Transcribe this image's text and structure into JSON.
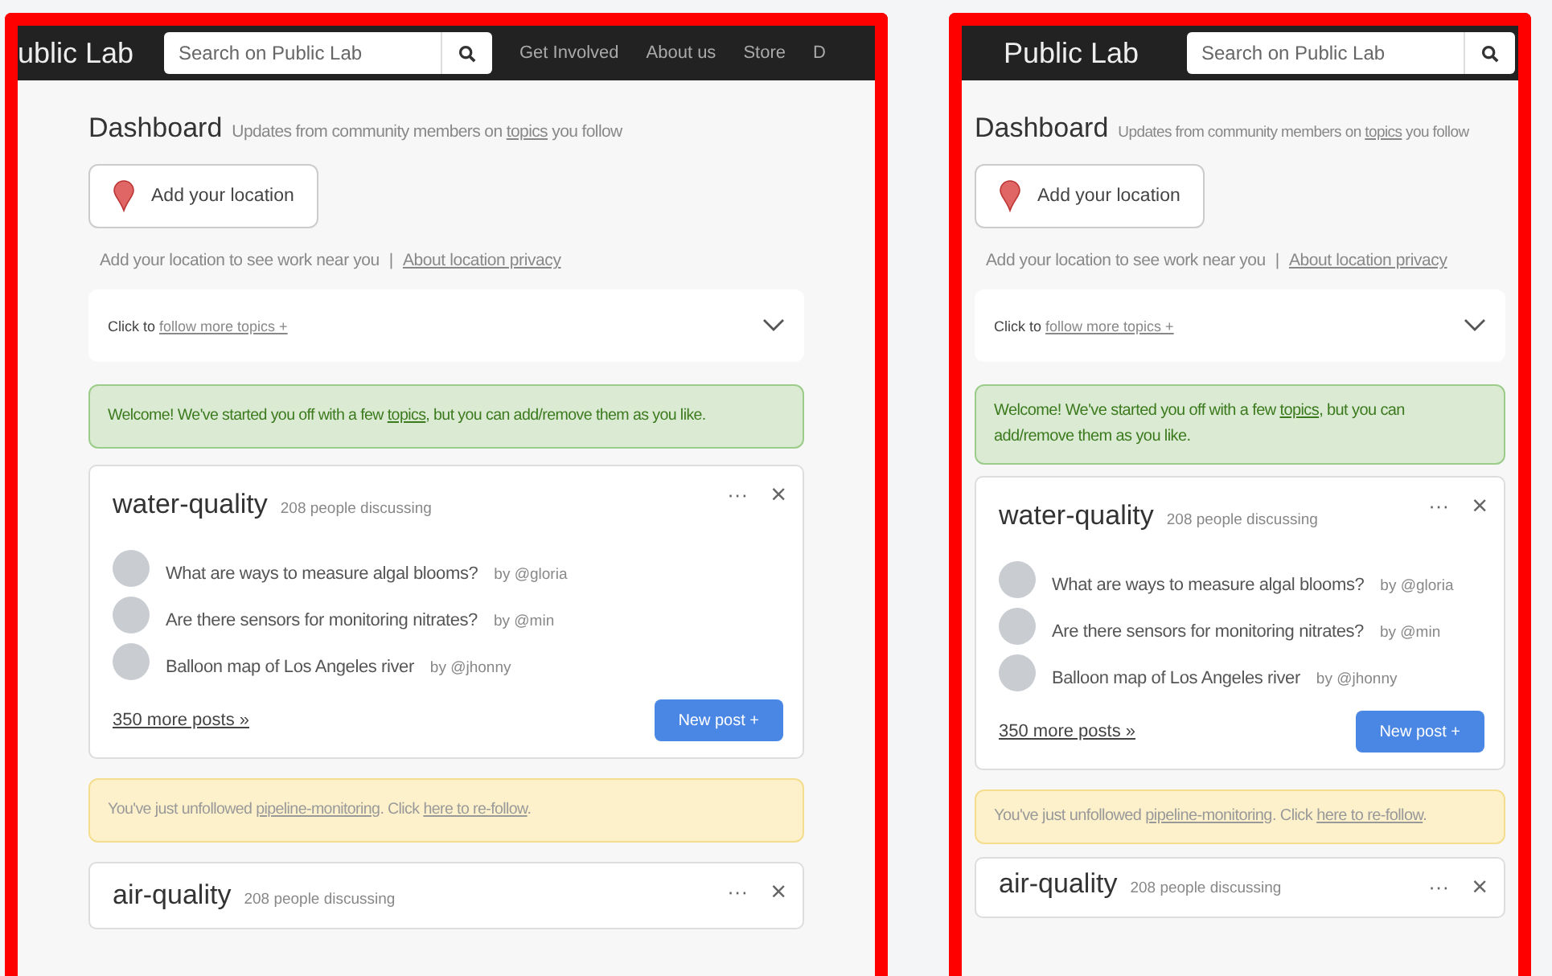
{
  "panels": [
    {
      "nav": {
        "logo": "ublic Lab",
        "search_placeholder": "Search on Public Lab",
        "links": [
          "Get Involved",
          "About us",
          "Store",
          "D"
        ]
      },
      "dashboard": {
        "title": "Dashboard",
        "subtitle": [
          {
            "text": "Updates from community members on "
          },
          {
            "link": "topics"
          },
          {
            "text": " you follow"
          }
        ]
      },
      "location": {
        "button": "Add your location",
        "note": "Add your location to see work near you",
        "separator": "|",
        "privacy_link": "About location privacy"
      },
      "follow": {
        "prefix": "Click to ",
        "link": "follow more topics +",
        "expanded": false
      },
      "welcome": [
        {
          "text": "Welcome! We've started you off with a few "
        },
        {
          "link": "topics"
        },
        {
          "text": ", but you can add/remove them as you like."
        }
      ],
      "topic_card": {
        "title": "water-quality",
        "count": "208 people discussing",
        "more_icon": "···",
        "close_icon": "×",
        "posts": [
          {
            "title": "What are ways to measure algal blooms?",
            "author": "by @gloria"
          },
          {
            "title": "Are there sensors for monitoring nitrates?",
            "author": "by @min"
          },
          {
            "title": "Balloon map of Los Angeles river",
            "author": "by @jhonny"
          }
        ],
        "more_posts": "350 more posts »",
        "new_post": "New post +"
      },
      "unfollow": [
        {
          "text": "You've just unfollowed "
        },
        {
          "link": "pipeline-monitoring"
        },
        {
          "text": ". Click "
        },
        {
          "link": "here to re-follow"
        },
        {
          "text": "."
        }
      ],
      "next_card": {
        "title": "air-quality",
        "count": "208 people discussing",
        "more_icon": "···",
        "close_icon": "×"
      }
    },
    {
      "nav": {
        "logo": "Public Lab",
        "search_placeholder": "Search on Public Lab"
      },
      "dashboard": {
        "title": "Dashboard",
        "subtitle": [
          {
            "text": "Updates from community members on "
          },
          {
            "link": "topics"
          },
          {
            "text": " you follow"
          }
        ]
      },
      "location": {
        "button": "Add your location",
        "note": "Add your location to see work near you",
        "separator": "|",
        "privacy_link": "About location privacy"
      },
      "follow": {
        "prefix": "Click to ",
        "link": "follow more topics +",
        "expanded": false
      },
      "welcome": [
        {
          "text": "Welcome! We've started you off with a few "
        },
        {
          "link": "topics"
        },
        {
          "text": ", but you can add/remove them as you like."
        }
      ],
      "topic_card": {
        "title": "water-quality",
        "count": "208 people discussing",
        "more_icon": "···",
        "close_icon": "×",
        "posts": [
          {
            "title": "What are ways to measure algal blooms?",
            "author": "by @gloria"
          },
          {
            "title": "Are there sensors for monitoring nitrates?",
            "author": "by @min"
          },
          {
            "title": "Balloon map of Los Angeles river",
            "author": "by @jhonny"
          }
        ],
        "more_posts": "350 more posts »",
        "new_post": "New post +"
      },
      "unfollow": [
        {
          "text": "You've just unfollowed "
        },
        {
          "link": "pipeline-monitoring"
        },
        {
          "text": ". Click "
        },
        {
          "link": "here to re-follow"
        },
        {
          "text": "."
        }
      ],
      "next_card": {
        "title": "air-quality",
        "count": "208 people discussing",
        "more_icon": "···",
        "close_icon": "×"
      }
    }
  ]
}
